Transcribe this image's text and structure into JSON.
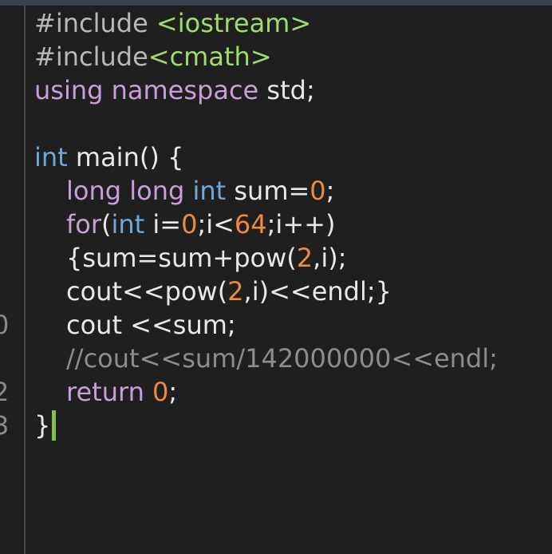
{
  "gutter": {
    "visible_numbers": [
      "0",
      "2",
      "3"
    ]
  },
  "code": {
    "l1": {
      "directive": "#include",
      "sp": " ",
      "header": "<iostream>"
    },
    "l2": {
      "directive": "#include",
      "header": "<cmath>"
    },
    "l3": {
      "kw_using": "using",
      "sp1": " ",
      "kw_namespace": "namespace",
      "rest": " std;"
    },
    "l5": {
      "type": "int",
      "rest": " main() {"
    },
    "l6": {
      "kw_long": "long long",
      "sp": " ",
      "type": "int",
      "mid": " sum=",
      "num": "0",
      "end": ";"
    },
    "l7": {
      "kw_for": "for",
      "p1": "(",
      "type": "int",
      "mid1": " i=",
      "num1": "0",
      "mid2": ";i<",
      "num2": "64",
      "end": ";i++)"
    },
    "l8": {
      "pre": "{sum=sum+pow(",
      "num": "2",
      "end": ",i);"
    },
    "l9": {
      "pre": "cout<<pow(",
      "num": "2",
      "end": ",i)<<endl;}"
    },
    "l10": {
      "text": "cout <<sum;"
    },
    "l11": {
      "comment": "//cout<<sum/142000000<<endl;"
    },
    "l12": {
      "kw_return": "return",
      "sp": " ",
      "num": "0",
      "end": ";"
    },
    "l13": {
      "brace": "}"
    }
  },
  "colors": {
    "background": "#1f1f1f",
    "keyword": "#c89fd6",
    "type": "#6fa8dc",
    "number": "#f08a3c",
    "string": "#9fdc6a",
    "comment": "#8c8c8c",
    "cursor": "#7dc242"
  }
}
